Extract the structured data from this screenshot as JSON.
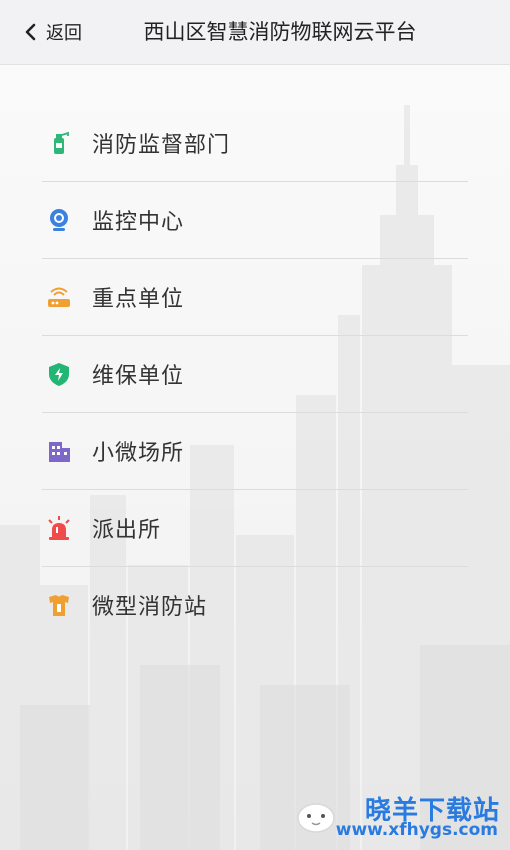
{
  "header": {
    "back_label": "返回",
    "title": "西山区智慧消防物联网云平台"
  },
  "menu": {
    "items": [
      {
        "label": "消防监督部门",
        "icon": "fire-extinguisher-icon",
        "color": "#2db87a"
      },
      {
        "label": "监控中心",
        "icon": "webcam-icon",
        "color": "#3b82e0"
      },
      {
        "label": "重点单位",
        "icon": "router-icon",
        "color": "#f0a030"
      },
      {
        "label": "维保单位",
        "icon": "shield-bolt-icon",
        "color": "#22b573"
      },
      {
        "label": "小微场所",
        "icon": "building-icon",
        "color": "#7b68c8"
      },
      {
        "label": "派出所",
        "icon": "police-siren-icon",
        "color": "#ef4b4b"
      },
      {
        "label": "微型消防站",
        "icon": "fire-station-icon",
        "color": "#f0a030"
      }
    ]
  },
  "watermark": {
    "main": "晓羊下载站",
    "url": "www.xfhygs.com",
    "color": "#2a7be0"
  }
}
